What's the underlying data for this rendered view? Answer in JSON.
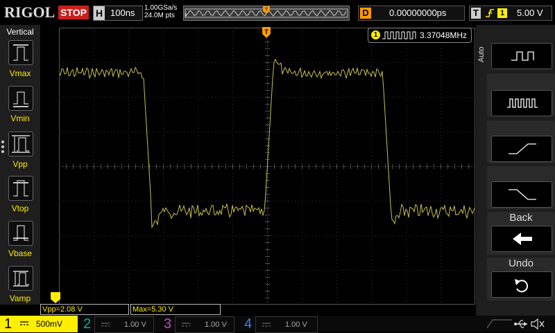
{
  "topbar": {
    "logo": "RIGOL",
    "run_state": "STOP",
    "horizontal_letter": "H",
    "timebase": "100ns",
    "sample_rate": "1.00GSa/s",
    "memory_depth": "24.0M pts",
    "delay_letter": "D",
    "delay_value": "0.00000000ps",
    "trigger_letter": "T",
    "trigger_channel": "1",
    "trigger_level": "5.00 V"
  },
  "left_panel": {
    "title": "Vertical",
    "items": [
      {
        "label": "Vmax"
      },
      {
        "label": "Vmin"
      },
      {
        "label": "Vpp"
      },
      {
        "label": "Vtop"
      },
      {
        "label": "Vbase"
      },
      {
        "label": "Vamp"
      }
    ]
  },
  "right_panel": {
    "mode_label": "Auto",
    "back_label": "Back",
    "undo_label": "Undo"
  },
  "frequency_readout": {
    "channel": "1",
    "value": "3.37048MHz"
  },
  "measurements": [
    {
      "text": "Vpp=2.08 V"
    },
    {
      "text": "Max=5.30 V"
    }
  ],
  "channels": [
    {
      "num": "1",
      "scale": "500mV",
      "active": true
    },
    {
      "num": "2",
      "scale": "1.00 V",
      "active": false
    },
    {
      "num": "3",
      "scale": "1.00 V",
      "active": false
    },
    {
      "num": "4",
      "scale": "1.00 V",
      "active": false
    }
  ],
  "colors": {
    "ch1": "#ffee00",
    "ch2": "#00b0a0",
    "ch3": "#d040d0",
    "ch4": "#3080ff",
    "trigger": "#ff9a00",
    "stop": "#c8201e"
  },
  "waveform": {
    "channel": "1",
    "shape": "square",
    "high_level_div": 2.7,
    "low_level_div": -1.3,
    "rising_edges_div": [
      6.05
    ],
    "falling_edges_div": [
      2.55,
      9.45
    ]
  }
}
